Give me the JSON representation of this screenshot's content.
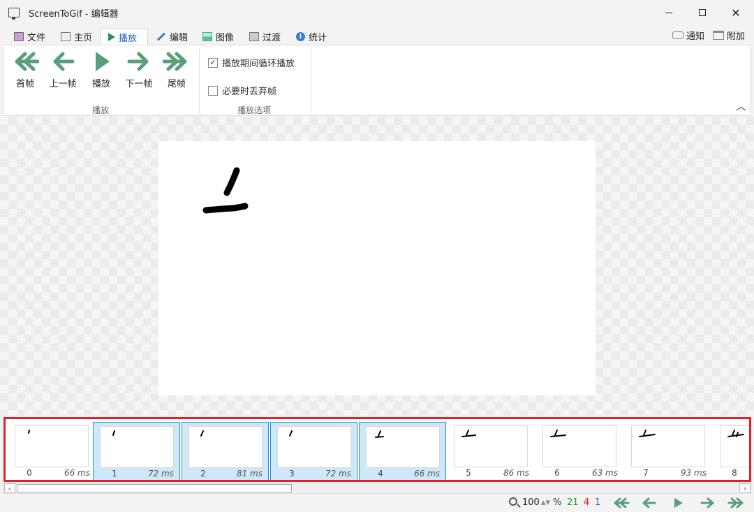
{
  "window": {
    "title": "ScreenToGif - 编辑器"
  },
  "tabs": [
    {
      "label": "文件",
      "icon": "save-icon"
    },
    {
      "label": "主页",
      "icon": "home-icon"
    },
    {
      "label": "播放",
      "icon": "play-icon",
      "active": true
    },
    {
      "label": "编辑",
      "icon": "pencil-icon"
    },
    {
      "label": "图像",
      "icon": "image-icon"
    },
    {
      "label": "过渡",
      "icon": "transition-icon"
    },
    {
      "label": "统计",
      "icon": "info-icon"
    }
  ],
  "right_tabs": {
    "notify": "通知",
    "extra": "附加"
  },
  "ribbon": {
    "playback_group": "播放",
    "playback_buttons": [
      "首帧",
      "上一帧",
      "播放",
      "下一帧",
      "尾帧"
    ],
    "options_group": "播放选项",
    "options": [
      {
        "label": "播放期间循环播放",
        "checked": true
      },
      {
        "label": "必要时丢弃帧",
        "checked": false
      }
    ]
  },
  "frames": [
    {
      "index": "0",
      "delay": "66 ms",
      "selected": false
    },
    {
      "index": "1",
      "delay": "72 ms",
      "selected": true
    },
    {
      "index": "2",
      "delay": "81 ms",
      "selected": true
    },
    {
      "index": "3",
      "delay": "72 ms",
      "selected": true
    },
    {
      "index": "4",
      "delay": "66 ms",
      "selected": true
    },
    {
      "index": "5",
      "delay": "86 ms",
      "selected": false
    },
    {
      "index": "6",
      "delay": "63 ms",
      "selected": false
    },
    {
      "index": "7",
      "delay": "93 ms",
      "selected": false
    },
    {
      "index": "8",
      "delay": "",
      "selected": false
    }
  ],
  "status": {
    "zoom": "100",
    "zoom_unit": "%",
    "total_frames": "21",
    "selected_frames": "4",
    "current_frame": "1"
  },
  "colors": {
    "accent_green": "#5a9e7c",
    "selection": "#cfe8f7",
    "highlight_border": "#e0202a"
  }
}
